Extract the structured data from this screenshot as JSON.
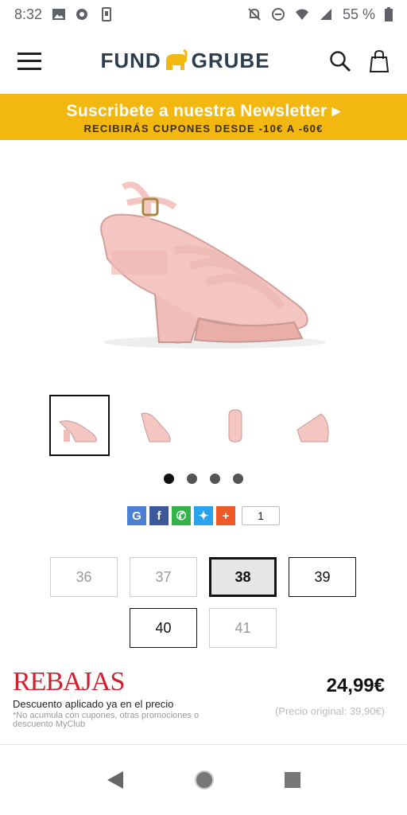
{
  "status_bar": {
    "time": "8:32",
    "battery": "55 %"
  },
  "header": {
    "logo_left": "FUND",
    "logo_right": "GRUBE"
  },
  "banner": {
    "title": "Suscribete a nuestra Newsletter ▸",
    "subtitle": "RECIBIRÁS CUPONES DESDE -10€ A -60€"
  },
  "gallery": {
    "thumb_count": 4,
    "active_index": 0
  },
  "share": {
    "count": "1"
  },
  "sizes": [
    {
      "label": "36",
      "state": "unavailable"
    },
    {
      "label": "37",
      "state": "unavailable"
    },
    {
      "label": "38",
      "state": "selected"
    },
    {
      "label": "39",
      "state": "available"
    },
    {
      "label": "40",
      "state": "available"
    },
    {
      "label": "41",
      "state": "unavailable"
    }
  ],
  "promo": {
    "title": "REBAJAS",
    "subtitle": "Descuento aplicado ya en el precio",
    "note": "*No acumula con cupones, otras promociones o descuento MyClub",
    "price": "24,99€",
    "original_price": "(Precio original: 39,90€)"
  },
  "colors": {
    "accent": "#f3b80f",
    "sale_red": "#d2202f",
    "shoe": "#f4c6c2"
  }
}
